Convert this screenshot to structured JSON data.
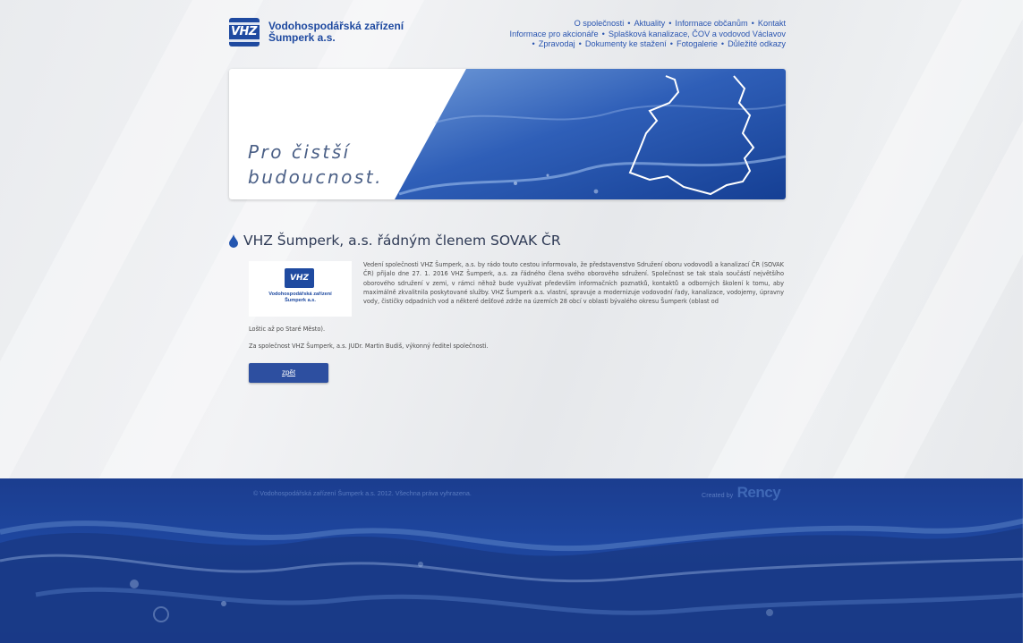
{
  "header": {
    "logo_abbr": "VHZ",
    "logo_line1": "Vodohospodářská zařízení",
    "logo_line2": "Šumperk a.s."
  },
  "nav": {
    "row1": [
      "O společnosti",
      "Aktuality",
      "Informace občanům",
      "Kontakt"
    ],
    "row2": [
      "Informace pro akcionáře",
      "Splašková kanalizace, ČOV a vodovod Václavov"
    ],
    "row3": [
      "Zpravodaj",
      "Dokumenty ke stažení",
      "Fotogalerie",
      "Důležité odkazy"
    ],
    "separator": "•"
  },
  "banner": {
    "slogan_line1": "Pro čistší",
    "slogan_line2": "budoucnost."
  },
  "article": {
    "title": "VHZ Šumperk, a.s. řádným členem SOVAK ČR",
    "thumb_abbr": "VHZ",
    "thumb_line1": "Vodohospodářská zařízení",
    "thumb_line2": "Šumperk a.s.",
    "paragraph": "Vedení společnosti VHZ Šumperk, a.s. by rádo touto cestou informovalo, že představenstvo Sdružení oboru vodovodů a kanalizací ČR (SOVAK ČR) přijalo dne 27. 1. 2016 VHZ Šumperk, a.s. za řádného člena svého oborového sdružení. Společnost se tak stala součástí největšího oborového sdružení v zemi, v rámci něhož bude využívat především informačních poznatků, kontaktů a odborných školení k tomu, aby maximálně zkvalitnila poskytované služby. VHZ Šumperk a.s. vlastní, spravuje a modernizuje vodovodní řady, kanalizace, vodojemy, úpravny vody, čističky odpadních vod a některé dešťové zdrže na územích 28 obcí v oblasti bývalého okresu Šumperk (oblast od",
    "paragraph_cont": "Loštic až po Staré Město).",
    "signature": "Za společnost VHZ Šumperk, a.s. JUDr. Martin Budiš, výkonný ředitel společnosti.",
    "back_label": "zpět"
  },
  "footer": {
    "copyright": "© Vodohospodářská zařízení Šumperk a.s. 2012. Všechna práva vyhrazena.",
    "created_by": "Created by",
    "created_brand": "Rency"
  },
  "colors": {
    "brand_blue": "#1f4aa0",
    "nav_link": "#2a55b0",
    "footer_blue": "#1e47a0"
  }
}
